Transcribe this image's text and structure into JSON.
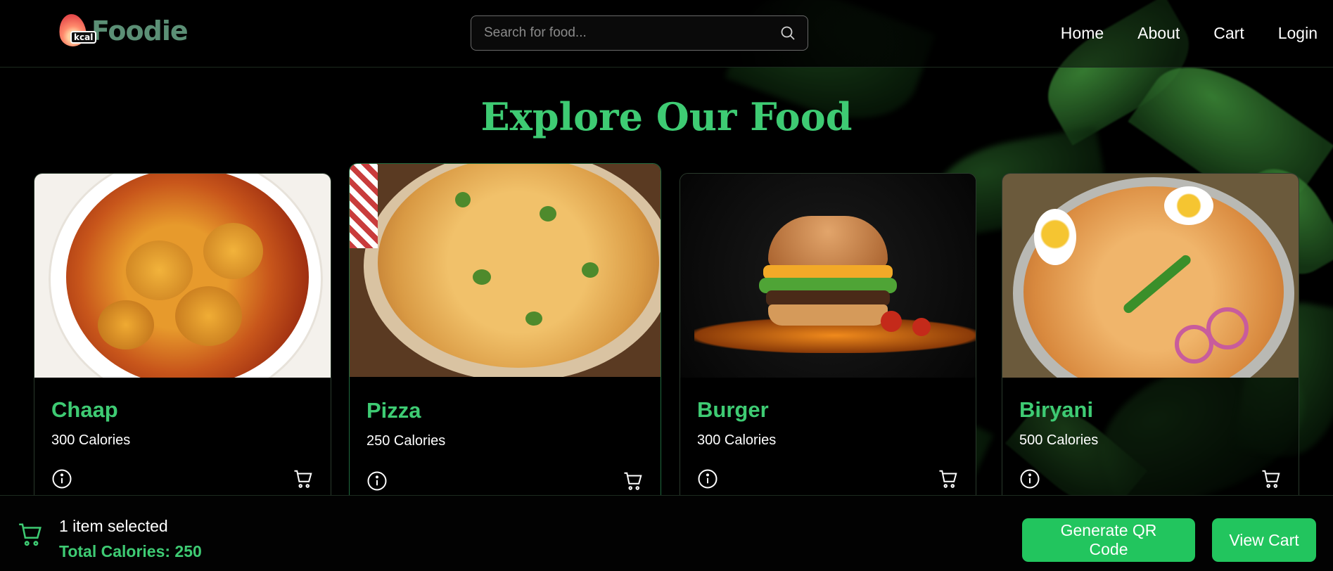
{
  "brand": {
    "badge": "kcal",
    "name": "Foodie"
  },
  "search": {
    "placeholder": "Search for food..."
  },
  "nav": {
    "items": [
      "Home",
      "About",
      "Cart",
      "Login"
    ]
  },
  "page_title": "Explore Our Food",
  "foods": [
    {
      "name": "Chaap",
      "calories": "300 Calories"
    },
    {
      "name": "Pizza",
      "calories": "250 Calories"
    },
    {
      "name": "Burger",
      "calories": "300 Calories"
    },
    {
      "name": "Biryani",
      "calories": "500 Calories"
    }
  ],
  "summary": {
    "selected": "1 item selected",
    "total": "Total Calories: 250"
  },
  "actions": {
    "qr": "Generate QR Code",
    "view_cart": "View Cart"
  },
  "icons": {
    "search": "search-icon",
    "info": "info-icon",
    "cart": "cart-icon"
  },
  "colors": {
    "accent": "#3ecb73",
    "button": "#22c55e",
    "background": "#000000"
  }
}
